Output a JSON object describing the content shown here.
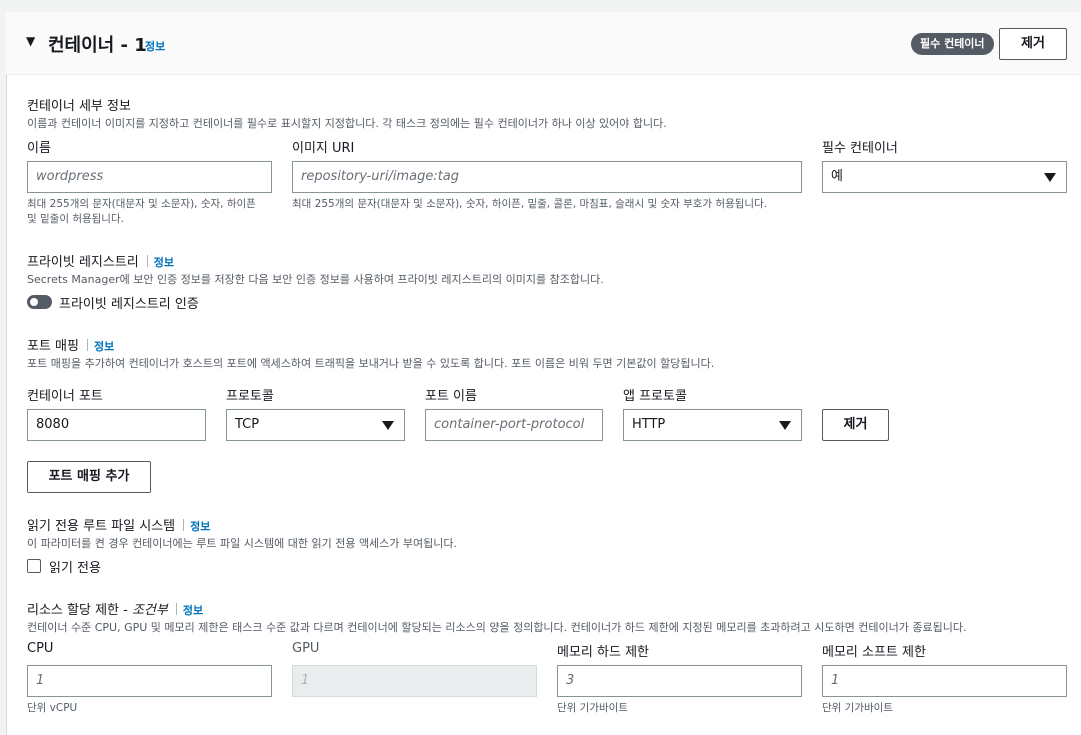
{
  "header": {
    "title": "컨테이너 - 1",
    "info": "정보",
    "essential_badge": "필수 컨테이너",
    "remove_button": "제거"
  },
  "details": {
    "title": "컨테이너 세부 정보",
    "description": "이름과 컨테이너 이미지를 지정하고 컨테이너를 필수로 표시할지 지정합니다. 각 태스크 정의에는 필수 컨테이너가 하나 이상 있어야 합니다.",
    "name_label": "이름",
    "name_placeholder": "wordpress",
    "name_hint_1": "최대 255개의 문자(대문자 및 소문자), 숫자, 하이픈",
    "name_hint_2": "및 밑줄이 허용됩니다.",
    "image_label": "이미지 URI",
    "image_placeholder": "repository-uri/image:tag",
    "image_hint": "최대 255개의 문자(대문자 및 소문자), 숫자, 하이픈, 밑줄, 콜론, 마침표, 슬래시 및 숫자 부호가 허용됩니다.",
    "essential_label": "필수 컨테이너",
    "essential_value": "예"
  },
  "private_registry": {
    "title": "프라이빗 레지스트리",
    "info": "정보",
    "description": "Secrets Manager에 보안 인증 정보를 저장한 다음 보안 인증 정보를 사용하여 프라이빗 레지스트리의 이미지를 참조합니다.",
    "toggle_label": "프라이빗 레지스트리 인증"
  },
  "port_mapping": {
    "title": "포트 매핑",
    "info": "정보",
    "description": "포트 매핑을 추가하여 컨테이너가 호스트의 포트에 액세스하여 트래픽을 보내거나 받을 수 있도록 합니다. 포트 이름은 비워 두면 기본값이 할당됩니다.",
    "container_port_label": "컨테이너 포트",
    "container_port_value": "8080",
    "protocol_label": "프로토콜",
    "protocol_value": "TCP",
    "port_name_label": "포트 이름",
    "port_name_placeholder": "container-port-protocol",
    "app_protocol_label": "앱 프로토콜",
    "app_protocol_value": "HTTP",
    "remove_button": "제거",
    "add_button": "포트 매핑 추가"
  },
  "readonly_fs": {
    "title": "읽기 전용 루트 파일 시스템",
    "info": "정보",
    "description": "이 파라미터를 켠 경우 컨테이너에는 루트 파일 시스템에 대한 읽기 전용 액세스가 부여됩니다.",
    "checkbox_label": "읽기 전용"
  },
  "resources": {
    "title": "리소스 할당 제한 - ",
    "title_optional": "조건부",
    "info": "정보",
    "description": "컨테이너 수준 CPU, GPU 및 메모리 제한은 태스크 수준 값과 다르며 컨테이너에 할당되는 리소스의 양을 정의합니다. 컨테이너가 하드 제한에 지정된 메모리를 초과하려고 시도하면 컨테이너가 종료됩니다.",
    "cpu_label": "CPU",
    "cpu_placeholder": "1",
    "cpu_hint": "단위 vCPU",
    "gpu_label": "GPU",
    "gpu_placeholder": "1",
    "mem_hard_label": "메모리 하드 제한",
    "mem_hard_placeholder": "3",
    "mem_hard_hint": "단위 기가바이트",
    "mem_soft_label": "메모리 소프트 제한",
    "mem_soft_placeholder": "1",
    "mem_soft_hint": "단위 기가바이트"
  }
}
